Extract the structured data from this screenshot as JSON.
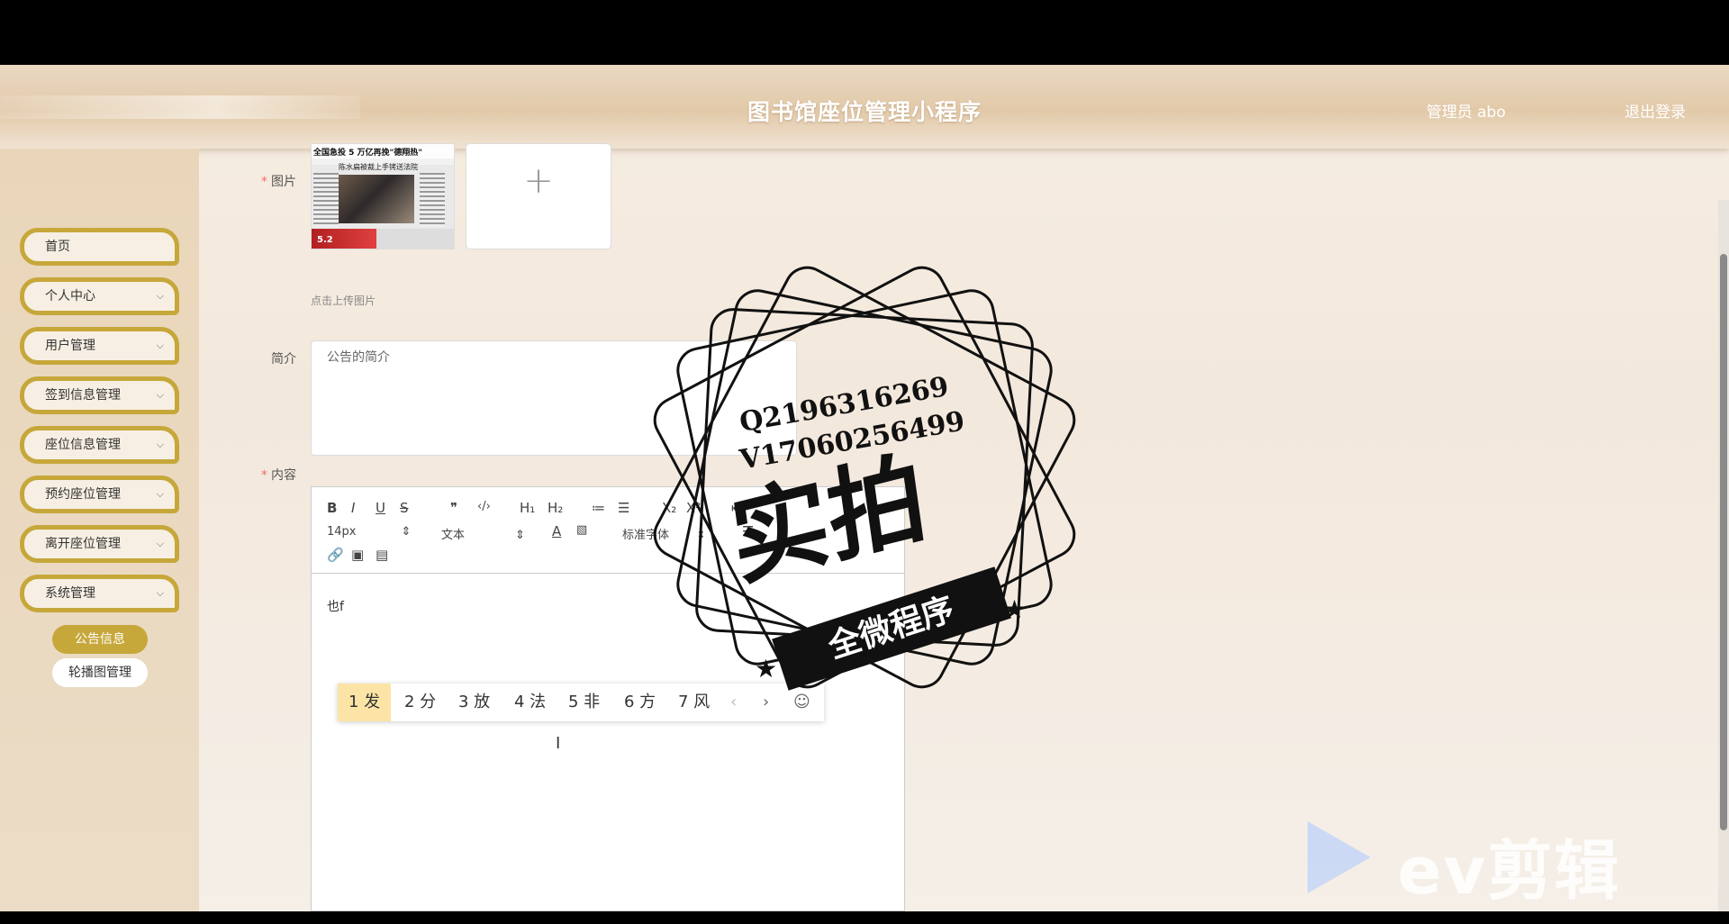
{
  "header": {
    "title": "图书馆座位管理小程序",
    "user_label": "管理员 abo",
    "logout_label": "退出登录"
  },
  "sidebar": {
    "items": [
      {
        "label": "首页",
        "has_arrow": false
      },
      {
        "label": "个人中心",
        "has_arrow": true
      },
      {
        "label": "用户管理",
        "has_arrow": true
      },
      {
        "label": "签到信息管理",
        "has_arrow": true
      },
      {
        "label": "座位信息管理",
        "has_arrow": true
      },
      {
        "label": "预约座位管理",
        "has_arrow": true
      },
      {
        "label": "离开座位管理",
        "has_arrow": true
      },
      {
        "label": "系统管理",
        "has_arrow": true
      }
    ],
    "sub_items": [
      {
        "label": "公告信息",
        "active": true
      },
      {
        "label": "轮播图管理",
        "active": false
      }
    ],
    "arrow_glyph": "⌵"
  },
  "form": {
    "image_label": "图片",
    "upload_hint": "点击上传图片",
    "summary_label": "简介",
    "summary_placeholder": "公告的简介",
    "content_label": "内容",
    "required_mark": "*"
  },
  "thumbnail": {
    "headline": "全国急投 5 万亿再挽\"德翔热\"",
    "subhead": "陈水扁被裁上手铐送法院",
    "footer": "5.2"
  },
  "editor": {
    "toolbar_row1": [
      "B",
      "I",
      "U",
      "S",
      "❞",
      "‹/›",
      "H₁",
      "H₂",
      "≔",
      "☰",
      "X₂",
      "X²",
      "⇤"
    ],
    "font_size": "14px",
    "format": "文本",
    "font_family": "标准字体",
    "body_text": "也f"
  },
  "ime": {
    "candidates": [
      "1 发",
      "2 分",
      "3 放",
      "4 法",
      "5 非",
      "6 方",
      "7 风"
    ],
    "prev": "‹",
    "next": "›",
    "emoji": "☺"
  },
  "watermark": {
    "qq": "Q2196316269",
    "wechat": "V17060256499",
    "big_text": "实拍",
    "ribbon_text": "全微程序"
  },
  "ev_logo": {
    "text": "ev剪辑"
  }
}
